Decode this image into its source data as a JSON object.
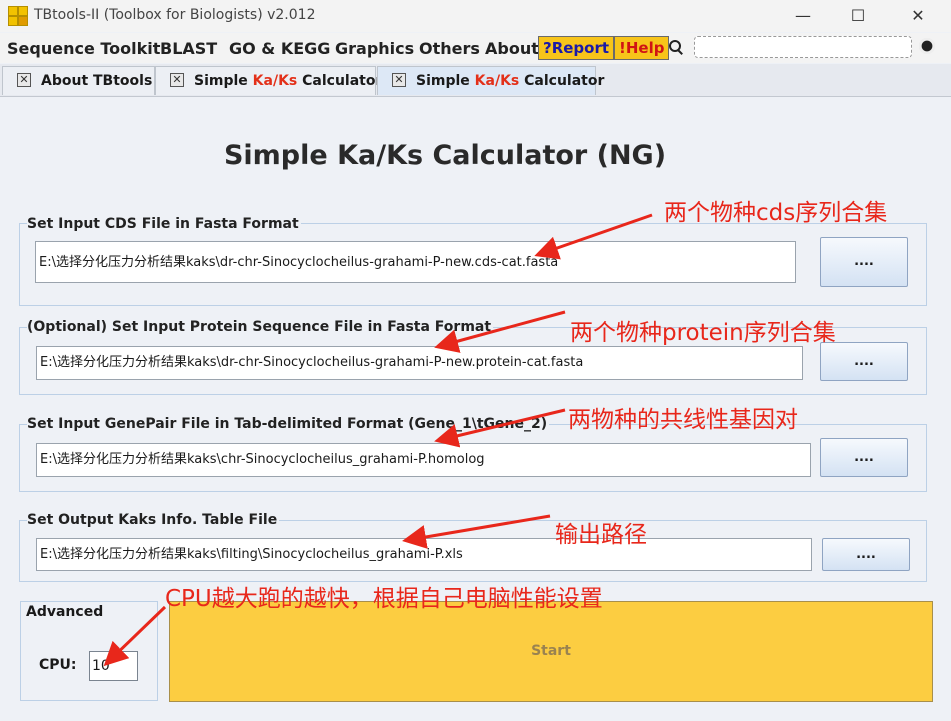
{
  "window": {
    "title": "TBtools-II (Toolbox for Biologists) v2.012",
    "minimize": "—",
    "maximize": "☐",
    "close": "✕"
  },
  "menu": {
    "items": [
      "Sequence Toolkit",
      "BLAST",
      "GO & KEGG",
      "Graphics",
      "Others",
      "About"
    ],
    "report": "?Report",
    "help": "!Help",
    "search_value": ""
  },
  "tabs": [
    {
      "label": "About TBtools"
    },
    {
      "label_prefix": "Simple ",
      "label_red": "Ka/Ks",
      "label_suffix": " Calculator"
    },
    {
      "label_prefix": "Simple ",
      "label_red": "Ka/Ks",
      "label_suffix": " Calculator"
    }
  ],
  "main": {
    "title": "Simple Ka/Ks Calculator (NG)",
    "cds": {
      "label": "Set Input CDS File in Fasta Format",
      "value": "E:\\选择分化压力分析结果kaks\\dr-chr-Sinocyclocheilus-grahami-P-new.cds-cat.fasta",
      "button": "...."
    },
    "protein": {
      "label": "(Optional) Set Input Protein Sequence File in Fasta Format",
      "value": "E:\\选择分化压力分析结果kaks\\dr-chr-Sinocyclocheilus-grahami-P-new.protein-cat.fasta",
      "button": "...."
    },
    "genepair": {
      "label": "Set Input GenePair File in Tab-delimited Format (Gene_1\\tGene_2)",
      "value": "E:\\选择分化压力分析结果kaks\\chr-Sinocyclocheilus_grahami-P.homolog",
      "button": "...."
    },
    "output": {
      "label": "Set Output Kaks Info. Table File",
      "value": "E:\\选择分化压力分析结果kaks\\filting\\Sinocyclocheilus_grahami-P.xls",
      "button": "...."
    },
    "advanced": {
      "label": "Advanced",
      "cpu_label": "CPU:",
      "cpu_value": "10"
    },
    "start": "Start"
  },
  "annotations": {
    "cds": "两个物种cds序列合集",
    "protein": "两个物种protein序列合集",
    "genepair": "两物种的共线性基因对",
    "output": "输出路径",
    "cpu": "CPU越大跑的越快，根据自己电脑性能设置"
  },
  "colors": {
    "accent_yellow": "#fccd41",
    "annotation_red": "#e8271b",
    "tab_red": "#e33019"
  }
}
